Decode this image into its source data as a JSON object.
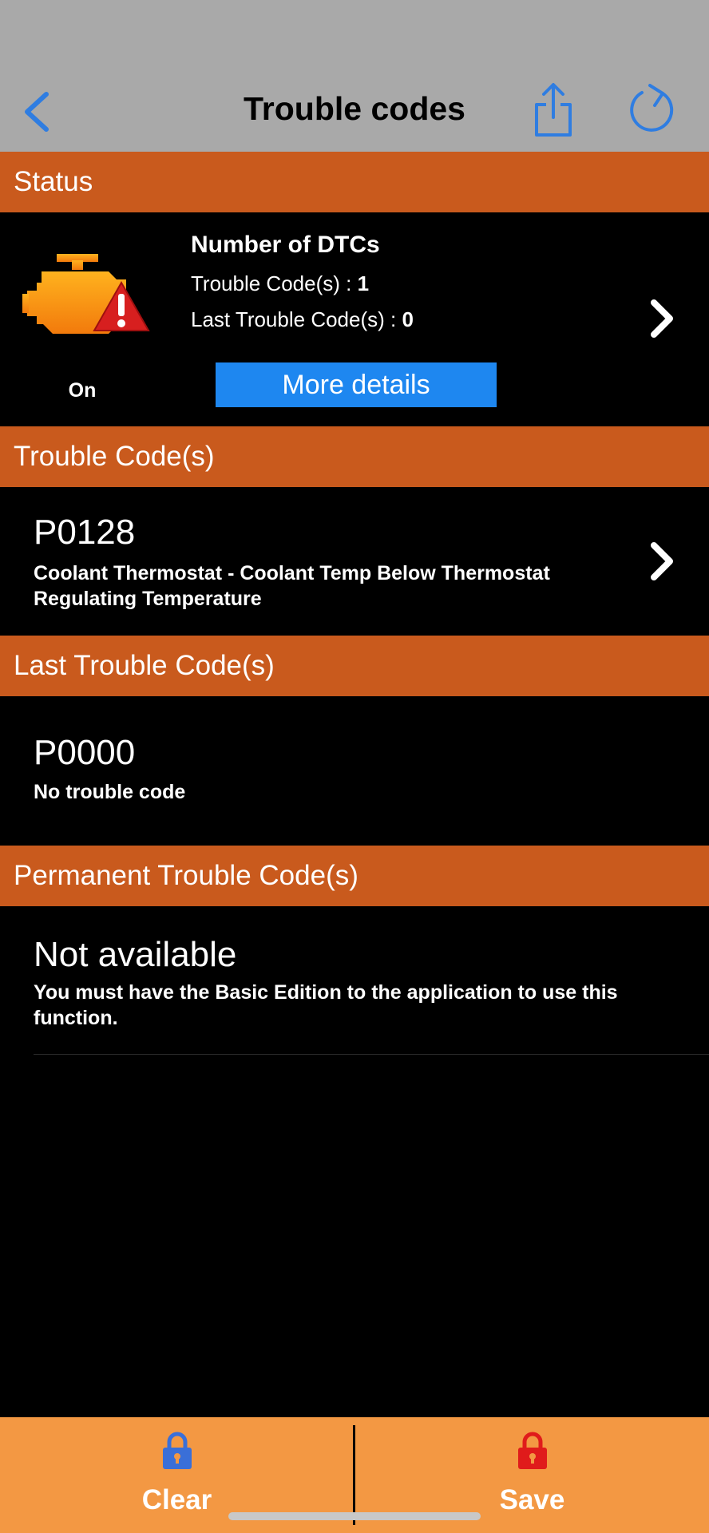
{
  "nav": {
    "title": "Trouble codes",
    "icons": [
      "back-chevron-icon",
      "share-icon",
      "refresh-icon"
    ],
    "accent_color": "#2f7de1"
  },
  "sections": {
    "status": "Status",
    "trouble_codes": "Trouble Code(s)",
    "last_trouble_codes": "Last Trouble Code(s)",
    "permanent_trouble_codes": "Permanent Trouble Code(s)"
  },
  "status": {
    "engine_icon": "check-engine-warning-icon",
    "engine_state": "On",
    "title": "Number of DTCs",
    "trouble_codes_label": "Trouble Code(s) : ",
    "trouble_codes_count": "1",
    "last_trouble_codes_label": "Last Trouble Code(s) : ",
    "last_trouble_codes_count": "0",
    "more_details_label": "More details"
  },
  "trouble_code": {
    "code": "P0128",
    "description": "Coolant Thermostat - Coolant Temp Below Thermostat Regulating Temperature"
  },
  "last_trouble_code": {
    "code": "P0000",
    "description": "No trouble code"
  },
  "permanent_trouble_code": {
    "title": "Not available",
    "description": "You must have the Basic Edition to the application to use this function."
  },
  "toolbar": {
    "clear_label": "Clear",
    "save_label": "Save",
    "clear_lock_color": "#3a6fd8",
    "save_lock_color": "#e01b1b"
  },
  "colors": {
    "section_header": "#c95a1d",
    "toolbar": "#f39843",
    "nav_bar": "#a9a9a9",
    "button_blue": "#1e87f0"
  }
}
